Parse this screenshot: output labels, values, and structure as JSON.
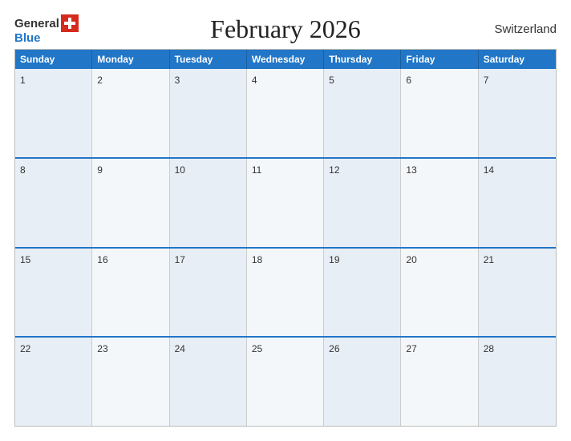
{
  "header": {
    "logo_general": "General",
    "logo_blue": "Blue",
    "title": "February 2026",
    "country": "Switzerland"
  },
  "calendar": {
    "days_of_week": [
      "Sunday",
      "Monday",
      "Tuesday",
      "Wednesday",
      "Thursday",
      "Friday",
      "Saturday"
    ],
    "weeks": [
      [
        {
          "day": "1"
        },
        {
          "day": "2"
        },
        {
          "day": "3"
        },
        {
          "day": "4"
        },
        {
          "day": "5"
        },
        {
          "day": "6"
        },
        {
          "day": "7"
        }
      ],
      [
        {
          "day": "8"
        },
        {
          "day": "9"
        },
        {
          "day": "10"
        },
        {
          "day": "11"
        },
        {
          "day": "12"
        },
        {
          "day": "13"
        },
        {
          "day": "14"
        }
      ],
      [
        {
          "day": "15"
        },
        {
          "day": "16"
        },
        {
          "day": "17"
        },
        {
          "day": "18"
        },
        {
          "day": "19"
        },
        {
          "day": "20"
        },
        {
          "day": "21"
        }
      ],
      [
        {
          "day": "22"
        },
        {
          "day": "23"
        },
        {
          "day": "24"
        },
        {
          "day": "25"
        },
        {
          "day": "26"
        },
        {
          "day": "27"
        },
        {
          "day": "28"
        }
      ]
    ]
  },
  "colors": {
    "header_bg": "#2176c7",
    "cell_odd": "#e8eef5",
    "cell_even": "#f4f7fa"
  }
}
